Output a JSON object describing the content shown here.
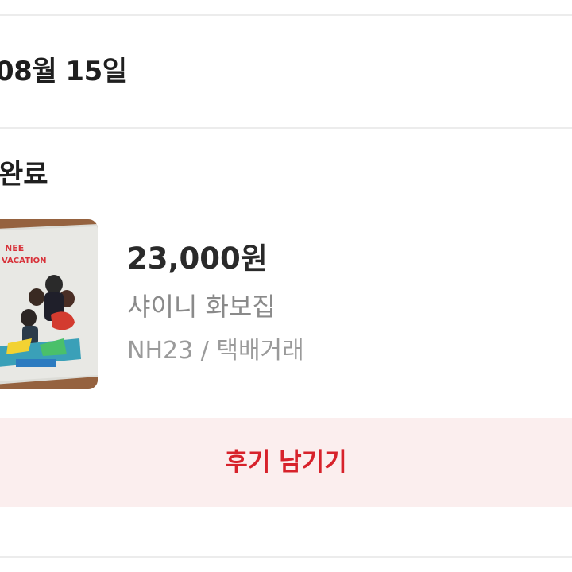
{
  "header": {
    "date": "08월 15일"
  },
  "order": {
    "status": "완료"
  },
  "product": {
    "price": "23,000원",
    "title": "샤이니 화보집",
    "meta": "NH23 / 택배거래",
    "thumbnail_text": [
      "NEE",
      "VACATION"
    ],
    "thumbnail_icon": "photo-book-cover"
  },
  "actions": {
    "review_label": "후기 남기기"
  },
  "colors": {
    "accent": "#d7222b",
    "button_bg": "#fbeeee",
    "divider": "#ececec"
  }
}
